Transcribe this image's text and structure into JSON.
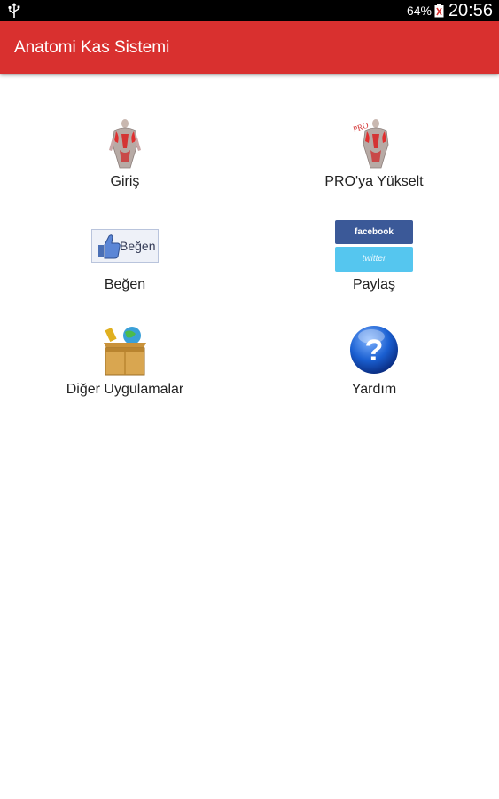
{
  "status_bar": {
    "battery_percent": "64%",
    "time": "20:56"
  },
  "app_bar": {
    "title": "Anatomi Kas Sistemi"
  },
  "menu": {
    "items": [
      {
        "label": "Giriş",
        "icon": "anatomy-muscle-icon"
      },
      {
        "label": "PRO'ya Yükselt",
        "icon": "anatomy-pro-icon"
      },
      {
        "label": "Beğen",
        "icon": "like-button-icon",
        "icon_text": "Beğen"
      },
      {
        "label": "Paylaş",
        "icon": "share-facebook-twitter-icon",
        "icon_text": [
          "facebook",
          "twitter"
        ]
      },
      {
        "label": "Diğer Uygulamalar",
        "icon": "apps-box-icon"
      },
      {
        "label": "Yardım",
        "icon": "help-question-icon",
        "icon_text": "?"
      }
    ]
  },
  "colors": {
    "app_bar": "#d9302f",
    "status_bar": "#000000",
    "facebook": "#3b5998",
    "twitter": "#55c6ef",
    "help": "#1a5fd1"
  }
}
